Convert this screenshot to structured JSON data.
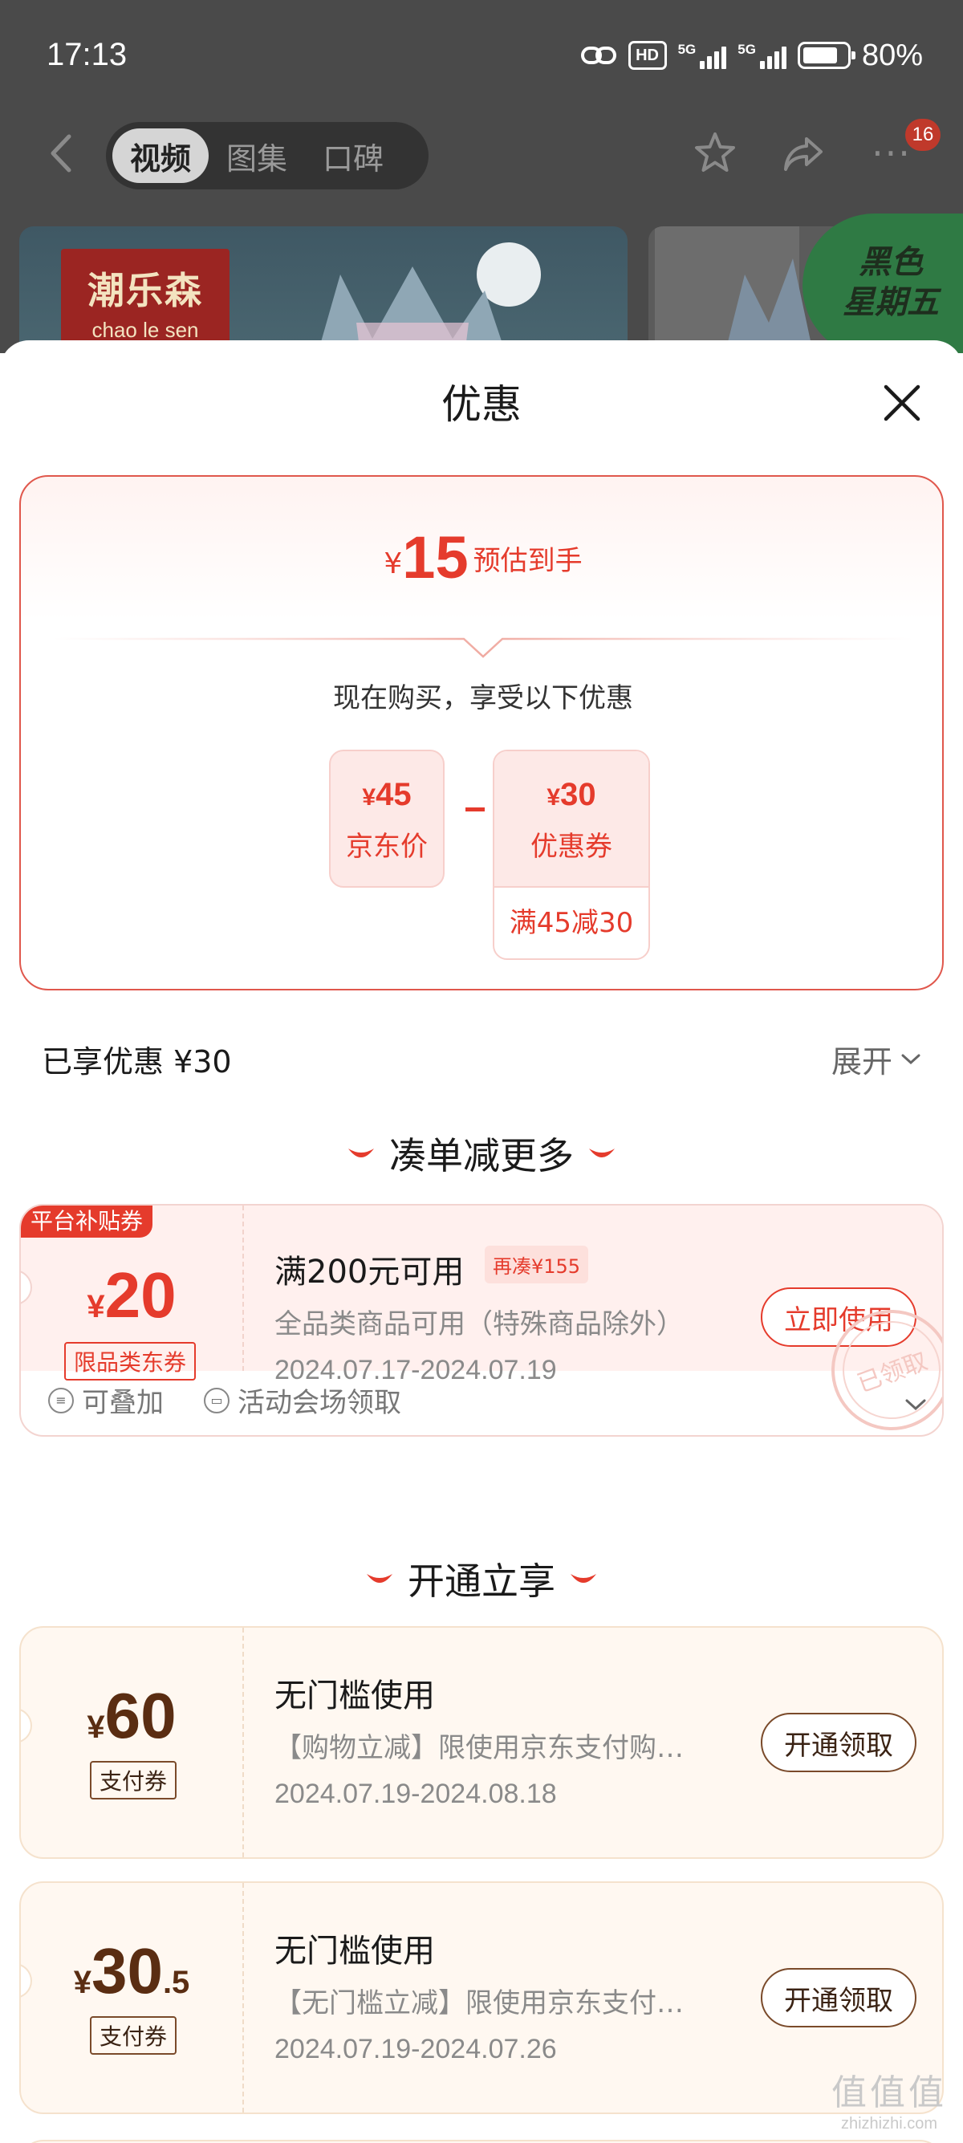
{
  "status_bar": {
    "time": "17:13",
    "hd": "HD",
    "net1": "5G",
    "net2": "5G",
    "battery": "80%",
    "battery_level": 0.8
  },
  "nav": {
    "tabs": [
      {
        "label": "视频",
        "active": true
      },
      {
        "label": "图集",
        "active": false
      },
      {
        "label": "口碑",
        "active": false
      }
    ],
    "more_badge": "16"
  },
  "product": {
    "logo_cn": "潮乐森",
    "logo_en": "chao le sen",
    "promo_badge": [
      "黑色",
      "星期五"
    ]
  },
  "sheet": {
    "title": "优惠",
    "estimate": {
      "currency": "¥",
      "amount": "15",
      "label": "预估到手"
    },
    "buy_now": "现在购买，享受以下优惠",
    "price_box": {
      "currency": "¥",
      "value": "45",
      "label": "京东价"
    },
    "coupon_box": {
      "currency": "¥",
      "value": "30",
      "label": "优惠券",
      "condition": "满45减30"
    },
    "enjoyed": "已享优惠 ¥30",
    "expand": "展开"
  },
  "section1": {
    "title": "凑单减更多"
  },
  "coupon_platform": {
    "tag": "平台补贴券",
    "currency": "¥",
    "amount": "20",
    "kind": "限品类东券",
    "title": "满200元可用",
    "pill": "再凑¥155",
    "desc": "全品类商品可用（特殊商品除外）",
    "date": "2024.07.17-2024.07.19",
    "button": "立即使用",
    "stamp": "已领取",
    "foot": [
      "可叠加",
      "活动会场领取"
    ]
  },
  "section2": {
    "title": "开通立享"
  },
  "coupons_gold": [
    {
      "currency": "¥",
      "amount": "60",
      "decimal": "",
      "kind": "支付券",
      "title": "无门槛使用",
      "desc": "【购物立减】限使用京东支付购…",
      "date": "2024.07.19-2024.08.18",
      "button": "开通领取"
    },
    {
      "currency": "¥",
      "amount": "30",
      "decimal": ".5",
      "kind": "支付券",
      "title": "无门槛使用",
      "desc": "【无门槛立减】限使用京东支付…",
      "date": "2024.07.19-2024.07.26",
      "button": "开通领取"
    }
  ],
  "watermark": {
    "main": "值值值",
    "sub": "zhizhizhi.com"
  },
  "colors": {
    "accent_red": "#e53b2c",
    "brown": "#7a4a2a",
    "overlay": "#4a4a4a"
  }
}
